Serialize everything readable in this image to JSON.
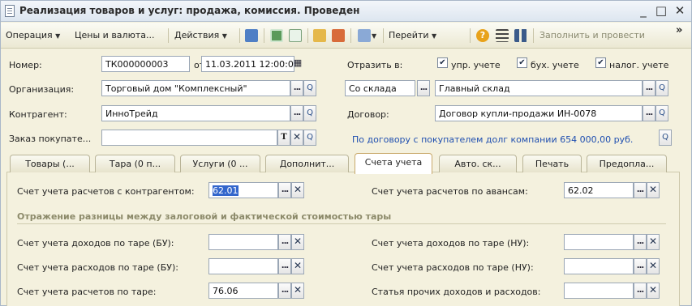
{
  "window": {
    "title": "Реализация товаров и услуг: продажа, комиссия. Проведен",
    "controls": [
      "_",
      "□",
      "✕"
    ]
  },
  "toolbar": {
    "operation": "Операция",
    "prices": "Цены и валюта...",
    "actions": "Действия",
    "goto": "Перейти",
    "fill_and_post": "Заполнить и провести",
    "more": "»"
  },
  "header": {
    "number_label": "Номер:",
    "number_value": "ТК000000003",
    "date_label": "от:",
    "date_value": "11.03.2011 12:00:00",
    "reflect_label": "Отразить в:",
    "checks": [
      {
        "label": "упр. учете",
        "checked": true
      },
      {
        "label": "бух. учете",
        "checked": true
      },
      {
        "label": "налог. учете",
        "checked": true
      }
    ],
    "org_label": "Организация:",
    "org_value": "Торговый дом \"Комплексный\"",
    "from_warehouse": "Со склада",
    "warehouse_value": "Главный склад",
    "contractor_label": "Контрагент:",
    "contractor_value": "ИнноТрейд",
    "contract_label": "Договор:",
    "contract_value": "Договор купли-продажи ИН-0078",
    "order_label": "Заказ покупате...",
    "order_value": "",
    "debt_text": "По договору с покупателем долг компании 654 000,00 руб."
  },
  "tabs": [
    {
      "label": "Товары (...",
      "active": false
    },
    {
      "label": "Тара (0 п...",
      "active": false
    },
    {
      "label": "Услуги (0 ...",
      "active": false
    },
    {
      "label": "Дополнит...",
      "active": false
    },
    {
      "label": "Счета учета",
      "active": true
    },
    {
      "label": "Авто. ск...",
      "active": false
    },
    {
      "label": "Печать",
      "active": false
    },
    {
      "label": "Предопла...",
      "active": false
    }
  ],
  "accounts": {
    "contractor_label": "Счет учета расчетов с контрагентом:",
    "contractor_value": "62.01",
    "advances_label": "Счет учета расчетов по авансам:",
    "advances_value": "62.02",
    "section_title": "Отражение разницы между залоговой и фактической стоимостью тары",
    "income_bu_label": "Счет учета доходов по таре (БУ):",
    "income_bu_value": "",
    "income_nu_label": "Счет учета доходов по таре (НУ):",
    "income_nu_value": "",
    "expense_bu_label": "Счет учета расходов по таре (БУ):",
    "expense_bu_value": "",
    "expense_nu_label": "Счет учета расходов по таре (НУ):",
    "expense_nu_value": "",
    "tare_label": "Счет учета расчетов по таре:",
    "tare_value": "76.06",
    "other_label": "Статья прочих доходов и расходов:",
    "other_value": ""
  }
}
